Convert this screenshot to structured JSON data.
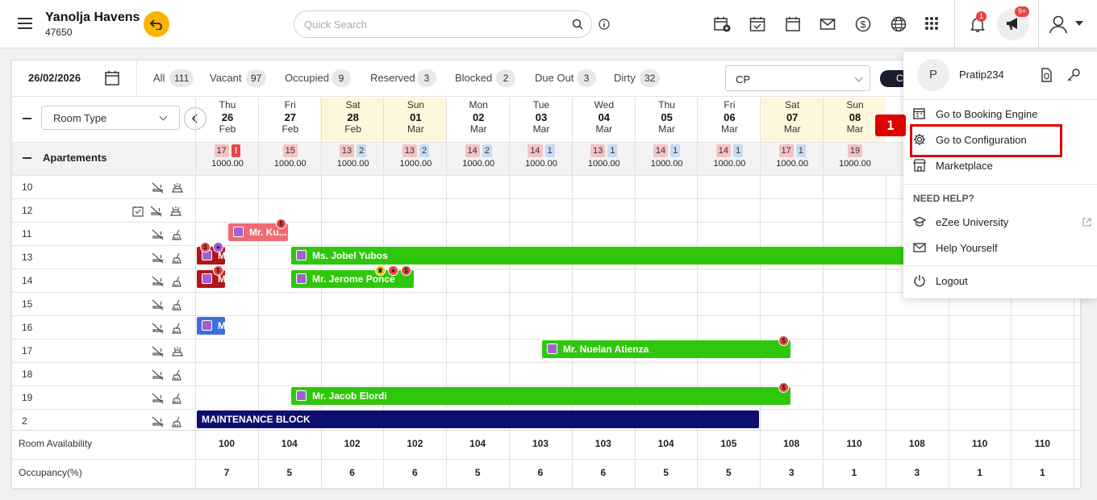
{
  "header": {
    "hotel_name": "Yanolja Havens",
    "hotel_id": "47650",
    "search_placeholder": "Quick Search",
    "notif_count": "1",
    "announce_count": "9+"
  },
  "filters": {
    "date": "26/02/2026",
    "items": [
      {
        "label": "All",
        "count": "111"
      },
      {
        "label": "Vacant",
        "count": "97"
      },
      {
        "label": "Occupied",
        "count": "9"
      },
      {
        "label": "Reserved",
        "count": "3"
      },
      {
        "label": "Blocked",
        "count": "2"
      },
      {
        "label": "Due Out",
        "count": "3"
      },
      {
        "label": "Dirty",
        "count": "32"
      }
    ],
    "rate_plan": "CP",
    "dark_button": "C"
  },
  "grid": {
    "room_type_label": "Room Type",
    "days": [
      {
        "dow": "Thu",
        "day": "26",
        "mon": "Feb"
      },
      {
        "dow": "Fri",
        "day": "27",
        "mon": "Feb"
      },
      {
        "dow": "Sat",
        "day": "28",
        "mon": "Feb"
      },
      {
        "dow": "Sun",
        "day": "01",
        "mon": "Mar"
      },
      {
        "dow": "Mon",
        "day": "02",
        "mon": "Mar"
      },
      {
        "dow": "Tue",
        "day": "03",
        "mon": "Mar"
      },
      {
        "dow": "Wed",
        "day": "04",
        "mon": "Mar"
      },
      {
        "dow": "Thu",
        "day": "05",
        "mon": "Mar"
      },
      {
        "dow": "Fri",
        "day": "06",
        "mon": "Mar"
      },
      {
        "dow": "Sat",
        "day": "07",
        "mon": "Mar"
      },
      {
        "dow": "Sun",
        "day": "08",
        "mon": "Mar"
      }
    ],
    "category": {
      "name": "Apartements",
      "cells": [
        {
          "r": "17",
          "b": "!",
          "p": "1000.00"
        },
        {
          "r": "15",
          "b": "",
          "p": "1000.00"
        },
        {
          "r": "13",
          "b": "2",
          "p": "1000.00"
        },
        {
          "r": "13",
          "b": "2",
          "p": "1000.00"
        },
        {
          "r": "14",
          "b": "2",
          "p": "1000.00"
        },
        {
          "r": "14",
          "b": "1",
          "p": "1000.00"
        },
        {
          "r": "13",
          "b": "1",
          "p": "1000.00"
        },
        {
          "r": "14",
          "b": "1",
          "p": "1000.00"
        },
        {
          "r": "14",
          "b": "1",
          "p": "1000.00"
        },
        {
          "r": "17",
          "b": "1",
          "p": "1000.00"
        },
        {
          "r": "19",
          "b": "",
          "p": "1000.00"
        }
      ]
    },
    "rooms": [
      "10",
      "12",
      "11",
      "13",
      "14",
      "15",
      "16",
      "17",
      "18",
      "19",
      "2"
    ],
    "bookings": [
      {
        "room": "11",
        "label": "Mr. Ku...",
        "color": "#ef6b73"
      },
      {
        "room": "13",
        "label": "M",
        "color": "#b0151a"
      },
      {
        "room": "13",
        "label": "Ms. Jobel Yubos",
        "color": "#2fc70c"
      },
      {
        "room": "14",
        "label": "M",
        "color": "#b0151a"
      },
      {
        "room": "14",
        "label": "Mr. Jerome Ponce",
        "color": "#2fc70c"
      },
      {
        "room": "16",
        "label": "M",
        "color": "#3d6fe0"
      },
      {
        "room": "17",
        "label": "Mr. Nuelan Atienza",
        "color": "#2fc70c"
      },
      {
        "room": "19",
        "label": "Mr. Jacob Elordi",
        "color": "#2fc70c"
      },
      {
        "room": "2",
        "label": "MAINTENANCE BLOCK",
        "color": "#0c0f6e"
      }
    ],
    "availability_label": "Room Availability",
    "availability": [
      "100",
      "104",
      "102",
      "102",
      "104",
      "103",
      "103",
      "104",
      "105",
      "108",
      "110",
      "108",
      "110",
      "110"
    ],
    "occupancy_label": "Occupancy(%)",
    "occupancy": [
      "7",
      "5",
      "6",
      "6",
      "5",
      "6",
      "6",
      "5",
      "5",
      "3",
      "1",
      "3",
      "1",
      "1"
    ]
  },
  "user_menu": {
    "avatar_letter": "P",
    "username": "Pratip234",
    "items": [
      {
        "label": "Go to Booking Engine",
        "icon": "booking-engine-icon"
      },
      {
        "label": "Go to Configuration",
        "icon": "gear-icon"
      },
      {
        "label": "Marketplace",
        "icon": "store-icon"
      }
    ],
    "need_help": "NEED HELP?",
    "help_items": [
      {
        "label": "eZee University",
        "icon": "graduation-cap-icon"
      },
      {
        "label": "Help Yourself",
        "icon": "mail-icon"
      }
    ],
    "logout": "Logout"
  },
  "annotation": {
    "step": "1"
  }
}
